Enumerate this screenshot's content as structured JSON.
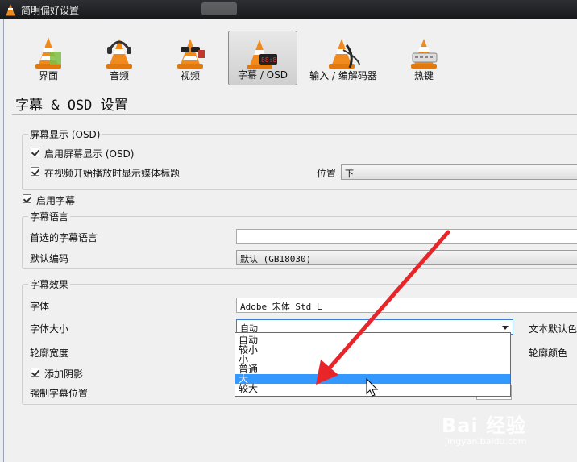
{
  "window": {
    "title": "简明偏好设置"
  },
  "tabs": [
    {
      "label": "界面",
      "icon": "cone-interface-icon",
      "active": false
    },
    {
      "label": "音频",
      "icon": "cone-headphones-icon",
      "active": false
    },
    {
      "label": "视频",
      "icon": "cone-glasses-icon",
      "active": false
    },
    {
      "label": "字幕 / OSD",
      "icon": "cone-clock-icon",
      "active": true
    },
    {
      "label": "输入 / 编解码器",
      "icon": "cone-cable-icon",
      "active": false
    },
    {
      "label": "热键",
      "icon": "cone-keyboard-icon",
      "active": false
    }
  ],
  "page": {
    "title": "字幕 & OSD 设置"
  },
  "osd": {
    "group_title": "屏幕显示 (OSD)",
    "enable_osd": {
      "label": "启用屏幕显示 (OSD)",
      "checked": true
    },
    "show_title": {
      "label": "在视频开始播放时显示媒体标题",
      "checked": true
    },
    "position_label": "位置",
    "position_value": "下"
  },
  "subtitles": {
    "enable": {
      "label": "启用字幕",
      "checked": true
    },
    "language_group_title": "字幕语言",
    "preferred_language_label": "首选的字幕语言",
    "preferred_language_value": "",
    "default_encoding_label": "默认编码",
    "default_encoding_value": "默认 (GB18030)"
  },
  "effects": {
    "group_title": "字幕效果",
    "font_label": "字体",
    "font_value": "Adobe 宋体 Std L",
    "font_size_label": "字体大小",
    "font_size_value": "自动",
    "font_size_options": [
      "自动",
      "较小",
      "小",
      "普通",
      "大",
      "较大"
    ],
    "font_size_highlighted": "大",
    "text_default_color_label": "文本默认色",
    "outline_width_label": "轮廓宽度",
    "outline_color_label": "轮廓颜色",
    "add_shadow": {
      "label": "添加阴影",
      "checked": true
    },
    "force_position_label": "强制字幕位置"
  },
  "watermark": {
    "main": "Bai 经验",
    "sub": "jingyan.baidu.com"
  },
  "colors": {
    "selection": "#3398ff",
    "annotation_arrow": "#e8262a",
    "cone_orange": "#f08a1c"
  }
}
